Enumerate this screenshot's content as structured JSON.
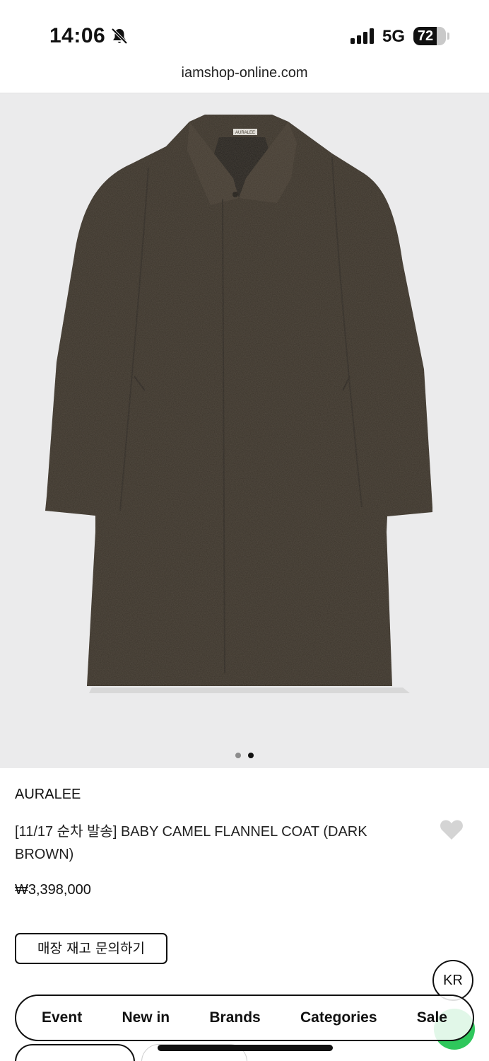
{
  "status_bar": {
    "time": "14:06",
    "network": "5G",
    "battery": "72",
    "battery_level": 0.72,
    "icons": [
      "bell-muted-icon",
      "signal-icon",
      "battery-icon"
    ]
  },
  "browser": {
    "url": "iamshop-online.com"
  },
  "gallery": {
    "image_count": 2,
    "active_index": 1
  },
  "product": {
    "brand": "AURALEE",
    "title": "[11/17 순차 발송] BABY CAMEL FLANNEL COAT (DARK BROWN)",
    "price": "₩3,398,000",
    "label_text": "AURALEE",
    "stock_inquiry_label": "매장 재고 문의하기"
  },
  "language_button": "KR",
  "bottom_nav": {
    "items": [
      "Event",
      "New in",
      "Brands",
      "Categories",
      "Sale"
    ]
  },
  "colors": {
    "coat": "#3b342b",
    "image_background": "#ebebec",
    "accent_green": "#2fc75c",
    "heart": "#d4d4d4"
  }
}
